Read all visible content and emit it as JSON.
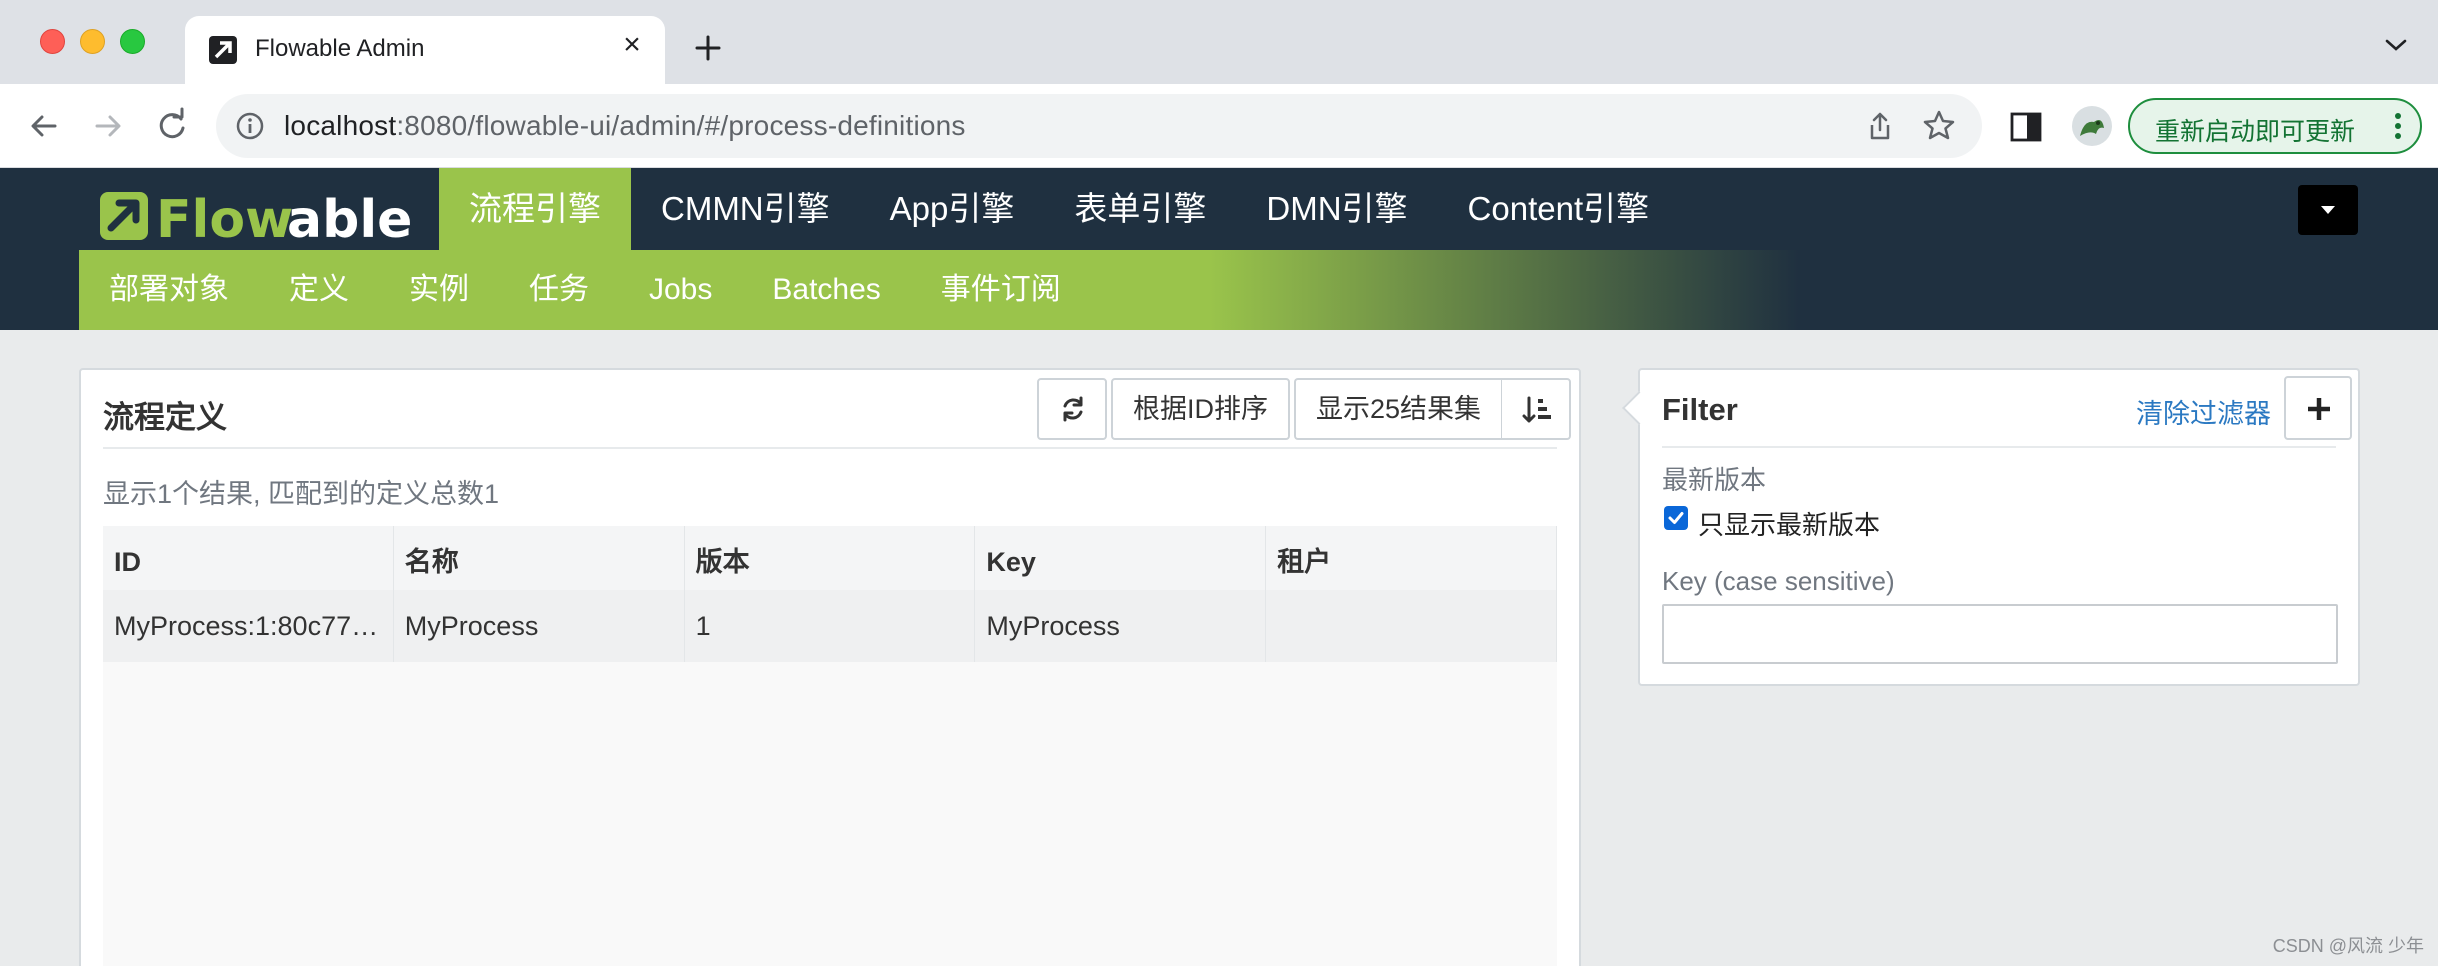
{
  "browser": {
    "tab_title": "Flowable Admin",
    "tab_close": "×",
    "url_host": "localhost",
    "url_rest": ":8080/flowable-ui/admin/#/process-definitions",
    "update_label": "重新启动即可更新"
  },
  "app": {
    "engine_tabs": [
      {
        "label": "流程引擎",
        "active": true
      },
      {
        "label": "CMMN引擎",
        "active": false
      },
      {
        "label": "App引擎",
        "active": false
      },
      {
        "label": "表单引擎",
        "active": false
      },
      {
        "label": "DMN引擎",
        "active": false
      },
      {
        "label": "Content引擎",
        "active": false
      }
    ],
    "sub_tabs": [
      "部署对象",
      "定义",
      "实例",
      "任务",
      "Jobs",
      "Batches",
      "事件订阅"
    ],
    "brand_colors": {
      "header": "#1f3040",
      "accent": "#9ac44b"
    }
  },
  "main": {
    "title": "流程定义",
    "sort_button": "根据ID排序",
    "count_button": "显示25结果集",
    "summary": "显示1个结果, 匹配到的定义总数1",
    "columns": [
      "ID",
      "名称",
      "版本",
      "Key",
      "租户"
    ],
    "rows": [
      [
        "MyProcess:1:80c77…",
        "MyProcess",
        "1",
        "MyProcess",
        ""
      ]
    ]
  },
  "filter": {
    "title": "Filter",
    "clear_label": "清除过滤器",
    "latest_label": "最新版本",
    "latest_checkbox_label": "只显示最新版本",
    "latest_checked": true,
    "key_label": "Key (case sensitive)",
    "key_value": ""
  },
  "watermark": "CSDN @风流 少年"
}
